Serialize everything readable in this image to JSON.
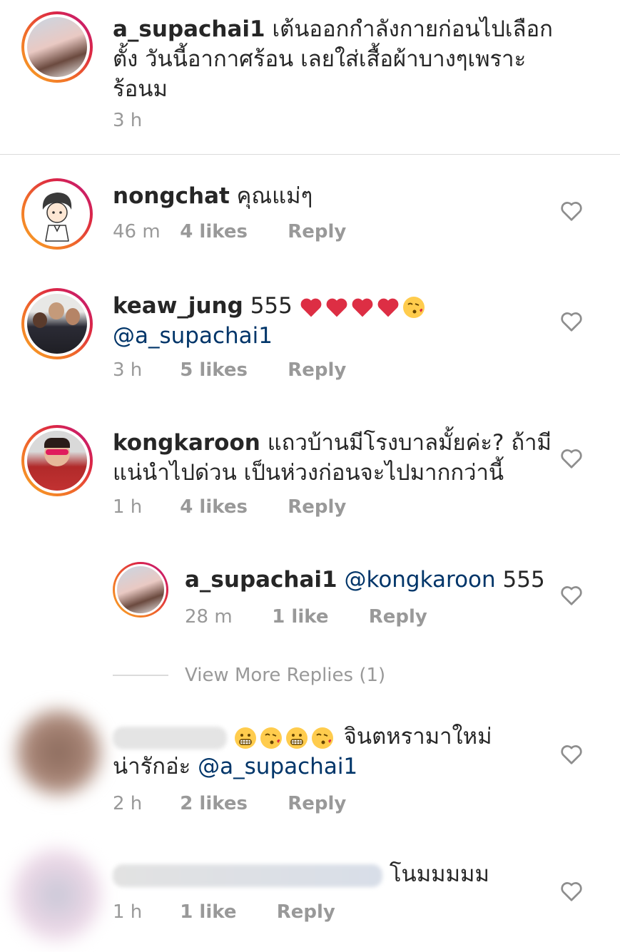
{
  "caption": {
    "username": "a_supachai1",
    "text": "เต้นออกกำลังกายก่อนไปเลือกตั้ง วันนี้อากาศร้อน เลยใส่เสื้อผ้าบางๆเพราะร้อนม",
    "time": "3 h"
  },
  "comments": [
    {
      "username": "nongchat",
      "text": "คุณแม่ๆ",
      "time": "46 m",
      "likes": "4 likes",
      "reply": "Reply"
    },
    {
      "username": "keaw_jung",
      "text": "555",
      "mention": "@a_supachai1",
      "time": "3 h",
      "likes": "5 likes",
      "reply": "Reply"
    },
    {
      "username": "kongkaroon",
      "text": "แถวบ้านมีโรงบาลมั้ยค่ะ? ถ้ามีแน่นำไปด่วน เป็นห่วงก่อนจะไปมากกว่านี้",
      "time": "1 h",
      "likes": "4 likes",
      "reply": "Reply"
    },
    {
      "username": "a_supachai1",
      "mention": "@kongkaroon",
      "text": "555",
      "time": "28 m",
      "likes": "1 like",
      "reply": "Reply"
    },
    {
      "text": "จินตหรามาใหม่",
      "text2": "น่ารักอ่ะ",
      "mention": "@a_supachai1",
      "time": "2 h",
      "likes": "2 likes",
      "reply": "Reply"
    },
    {
      "text": "โนมมมมม",
      "time": "1 h",
      "likes": "1 like",
      "reply": "Reply"
    }
  ],
  "view_more_replies": "View More Replies (1)",
  "icons": {
    "like": "heart-outline-icon",
    "emoji_heart": "red-heart-emoji",
    "emoji_kiss": "kiss-emoji",
    "emoji_grimace": "grimace-emoji"
  },
  "colors": {
    "text": "#262626",
    "meta": "#999999",
    "mention": "#003569",
    "ring_start": "#f9a825",
    "ring_end": "#bc1888"
  }
}
